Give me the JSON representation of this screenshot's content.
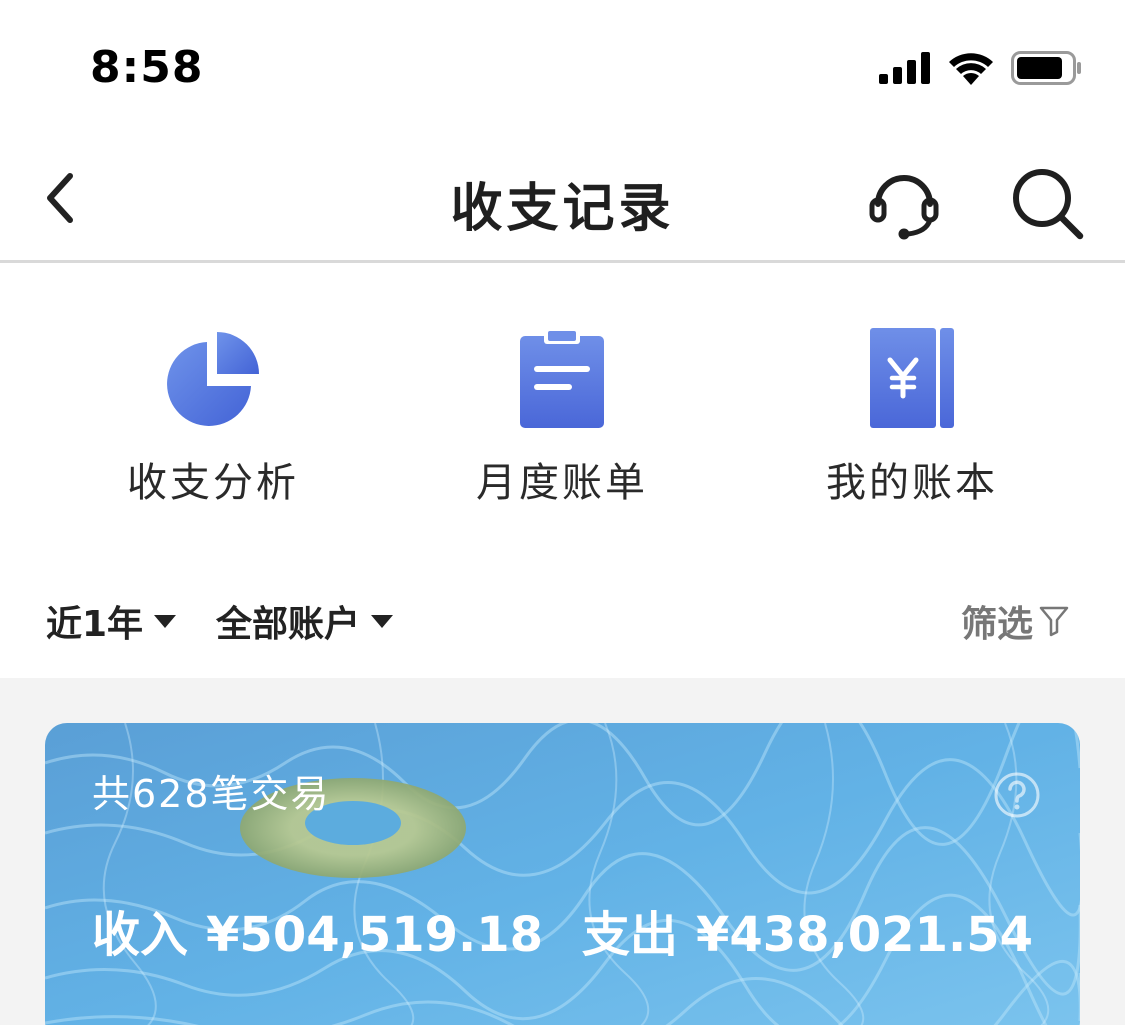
{
  "status_bar": {
    "time": "8:58",
    "icons": [
      "cellular-signal-icon",
      "wifi-icon",
      "battery-icon"
    ]
  },
  "nav": {
    "title": "收支记录",
    "icons": [
      "back-chevron-icon",
      "customer-service-headset-icon",
      "search-icon"
    ]
  },
  "quick_actions": [
    {
      "label": "收支分析",
      "icon": "pie-chart-icon"
    },
    {
      "label": "月度账单",
      "icon": "clipboard-bill-icon"
    },
    {
      "label": "我的账本",
      "icon": "yuan-ledger-book-icon"
    }
  ],
  "filters": {
    "period": "近1年",
    "account": "全部账户",
    "screen": "筛选",
    "icons": [
      "dropdown-triangle-icon",
      "filter-funnel-icon"
    ]
  },
  "summary": {
    "count_text": "共628笔交易",
    "income_label": "收入",
    "income_value": "¥504,519.18",
    "expense_label": "支出",
    "expense_value": "¥438,021.54",
    "help_icon": "question-circle-icon",
    "background": "pool-water-swim-ring-image"
  },
  "colors": {
    "accent_blue": "#4d6fde",
    "accent_blue_light": "#6f8fe8",
    "card_water": "#5aaee0",
    "divider": "#d9d9d9",
    "gray_bg": "#f3f3f3"
  }
}
